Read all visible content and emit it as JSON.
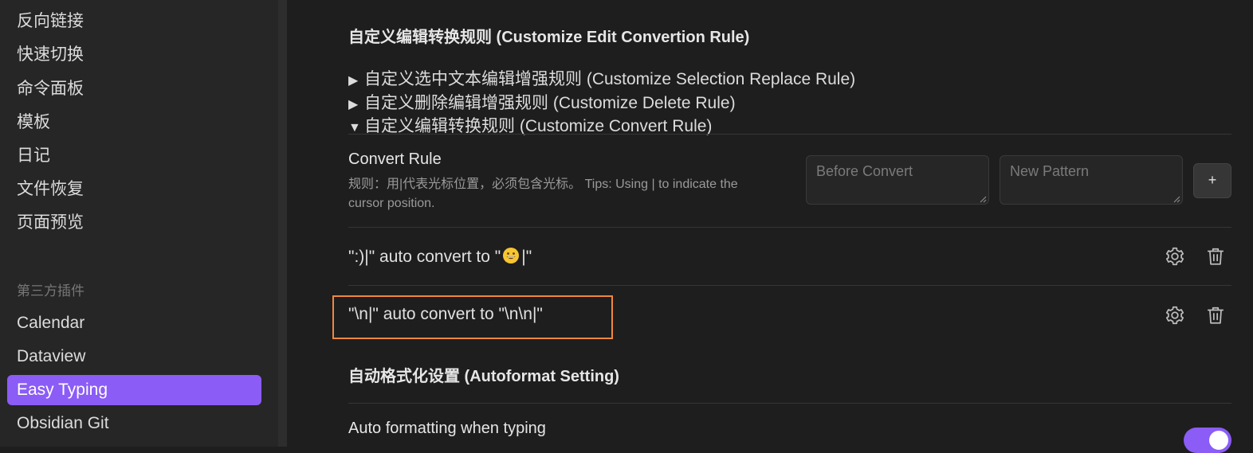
{
  "sidebar": {
    "items": [
      {
        "label": "反向链接"
      },
      {
        "label": "快速切换"
      },
      {
        "label": "命令面板"
      },
      {
        "label": "模板"
      },
      {
        "label": "日记"
      },
      {
        "label": "文件恢复"
      },
      {
        "label": "页面预览"
      }
    ],
    "plugins_heading": "第三方插件",
    "plugins": [
      {
        "label": "Calendar"
      },
      {
        "label": "Dataview"
      },
      {
        "label": "Easy Typing",
        "active": true
      },
      {
        "label": "Obsidian Git"
      }
    ]
  },
  "main": {
    "section_title": "自定义编辑转换规则 (Customize Edit Convertion Rule)",
    "details": [
      {
        "marker": "▶",
        "label": "自定义选中文本编辑增强规则 (Customize Selection Replace Rule)"
      },
      {
        "marker": "▶",
        "label": "自定义删除编辑增强规则 (Customize Delete Rule)"
      },
      {
        "marker": "▼",
        "label": "自定义编辑转换规则 (Customize Convert Rule)"
      }
    ],
    "convert_rule": {
      "name": "Convert Rule",
      "desc_line1": "规则：用|代表光标位置，必须包含光标。 Tips: Using | to indicate the",
      "desc_line2": "cursor position.",
      "before_placeholder": "Before Convert",
      "pattern_placeholder": "New Pattern",
      "add_label": "+"
    },
    "rules": [
      {
        "before": "\":)|\" auto convert to \"",
        "emoji": "grinning-face",
        "after": "|\""
      },
      {
        "text": "\"\\n|\" auto convert to \"\\n\\n|\""
      }
    ],
    "autoformat_title": "自动格式化设置 (Autoformat Setting)",
    "autoformat_setting": {
      "name": "Auto formatting when typing",
      "enabled": true
    }
  },
  "colors": {
    "accent": "#8b5cf6",
    "highlight_border": "#f0883e"
  }
}
